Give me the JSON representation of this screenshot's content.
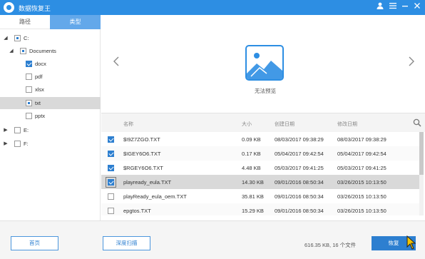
{
  "app": {
    "title": "数据恢复王"
  },
  "tabs": {
    "path": "路径",
    "type": "类型"
  },
  "tree": [
    {
      "label": "C:",
      "expander": "◢",
      "state": "partial",
      "indent": 0
    },
    {
      "label": "Documents",
      "expander": "◢",
      "state": "partial",
      "indent": 1
    },
    {
      "label": "docx",
      "expander": "",
      "state": "checked",
      "indent": 2
    },
    {
      "label": "pdf",
      "expander": "",
      "state": "unchecked",
      "indent": 2
    },
    {
      "label": "xlsx",
      "expander": "",
      "state": "unchecked",
      "indent": 2
    },
    {
      "label": "txt",
      "expander": "",
      "state": "partial",
      "indent": 2,
      "selected": true
    },
    {
      "label": "pptx",
      "expander": "",
      "state": "unchecked",
      "indent": 2
    },
    {
      "label": "E:",
      "expander": "▶",
      "state": "unchecked",
      "indent": 0
    },
    {
      "label": "F:",
      "expander": "▶",
      "state": "unchecked",
      "indent": 0
    }
  ],
  "preview": {
    "no_preview_text": "无法预览",
    "prev_icon": "chevron-left-icon",
    "next_icon": "chevron-right-icon"
  },
  "table": {
    "columns": {
      "name": "名称",
      "size": "大小",
      "created": "创建日期",
      "modified": "修改日期"
    },
    "rows": [
      {
        "checked": true,
        "name": "$I9Z7ZGO.TXT",
        "size": "0.09 KB",
        "created": "08/03/2017 09:38:29",
        "modified": "08/03/2017 09:38:29"
      },
      {
        "checked": true,
        "name": "$IGEY6O6.TXT",
        "size": "0.17 KB",
        "created": "05/04/2017 09:42:54",
        "modified": "05/04/2017 09:42:54"
      },
      {
        "checked": true,
        "name": "$RGEY6O6.TXT",
        "size": "4.48 KB",
        "created": "05/03/2017 09:41:25",
        "modified": "05/03/2017 09:41:25"
      },
      {
        "checked": true,
        "name": "playready_eula.TXT",
        "size": "14.30 KB",
        "created": "09/01/2016 08:50:34",
        "modified": "03/26/2015 10:13:50",
        "selected": true
      },
      {
        "checked": false,
        "name": "playReady_eula_oem.TXT",
        "size": "35.81 KB",
        "created": "09/01/2016 08:50:34",
        "modified": "03/26/2015 10:13:50"
      },
      {
        "checked": false,
        "name": "epgtos.TXT",
        "size": "15.29 KB",
        "created": "09/01/2016 08:50:34",
        "modified": "03/26/2015 10:13:50"
      }
    ]
  },
  "footer": {
    "home_button": "首页",
    "deep_scan_button": "深度扫描",
    "summary": "616.35 KB, 16 个文件",
    "recover_button": "恢复"
  },
  "colors": {
    "accent": "#2d8ee3",
    "tab_active": "#63a8ea",
    "selected_row": "#d9d9d9"
  }
}
